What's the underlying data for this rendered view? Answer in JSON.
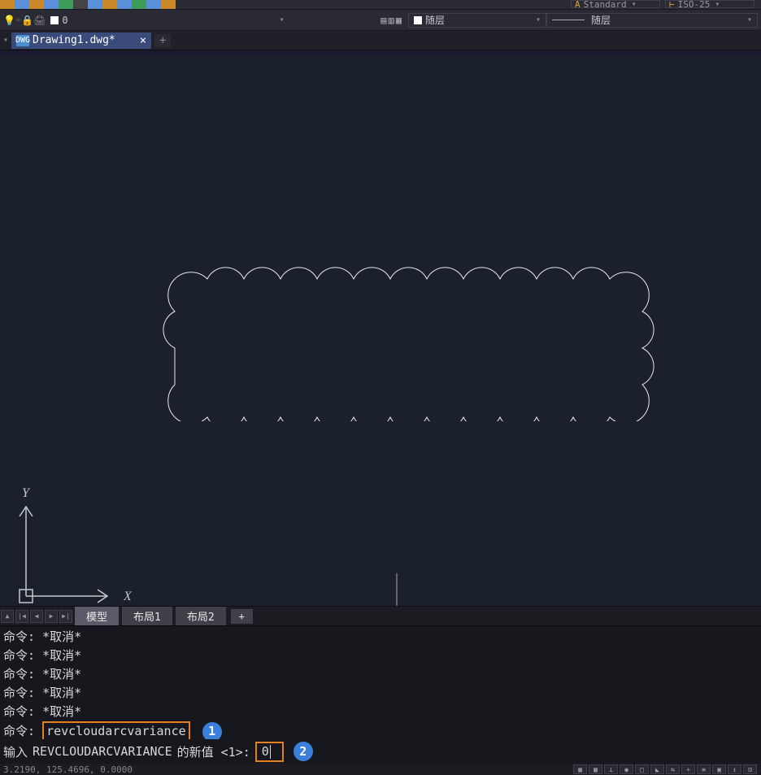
{
  "styles": {
    "text_style": "Standard",
    "dim_style": "ISO-25"
  },
  "layers": {
    "name": "0",
    "bylayer1": "随层",
    "bylayer2": "随层"
  },
  "tabs": {
    "active": "Drawing1.dwg*",
    "new_tab": "+"
  },
  "viewtabs": {
    "model": "模型",
    "layout1": "布局1",
    "layout2": "布局2"
  },
  "status": {
    "coords": "3.2190, 125.4696, 0.0000"
  },
  "command": {
    "prefix": "命令:",
    "cancel": "*取消*",
    "history_cmd": "revcloudarcvariance",
    "prompt_prefix": "输入",
    "prompt_var": "REVCLOUDARCVARIANCE",
    "prompt_suffix": "的新值 <1>:",
    "input_value": "0"
  },
  "badges": {
    "one": "1",
    "two": "2"
  }
}
